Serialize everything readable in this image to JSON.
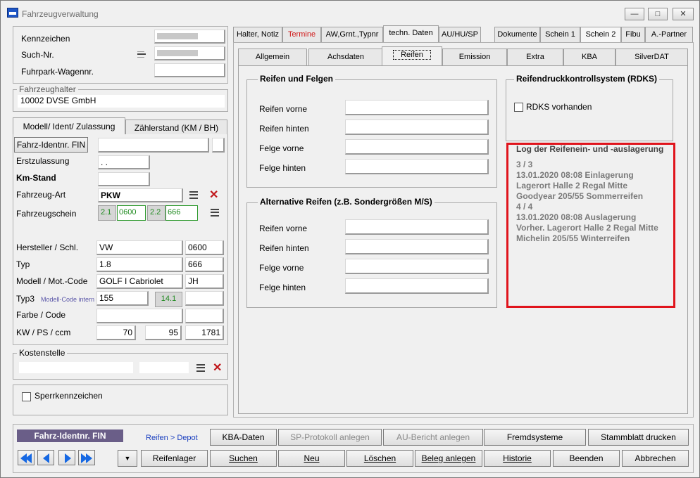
{
  "window": {
    "title": "Fahrzeugverwaltung"
  },
  "header": {
    "kennzeichen_label": "Kennzeichen",
    "such_nr_label": "Such-Nr.",
    "fuhrpark_label": "Fuhrpark-Wagennr."
  },
  "halter": {
    "group_title": "Fahrzeughalter",
    "value": "10002 DVSE GmbH"
  },
  "left_tabs": {
    "tab1": "Modell/ Ident/ Zulassung",
    "tab2": "Zählerstand (KM / BH)"
  },
  "vehicle": {
    "fin_button": "Fahrz-Identnr. FIN",
    "erstzulassung_label": "Erstzulassung",
    "erstzulassung_value": ". .",
    "kmstand_label": "Km-Stand",
    "art_label": "Fahrzeug-Art",
    "art_value": "PKW",
    "schein_label": "Fahrzeugschein",
    "schein_21": "2.1",
    "schein_21_value": "0600",
    "schein_22": "2.2",
    "schein_22_value": "666",
    "hersteller_label": "Hersteller / Schl.",
    "hersteller_value": "VW",
    "hersteller_key": "0600",
    "typ_label": "Typ",
    "typ_value": "1.8",
    "typ_key": "666",
    "modell_label": "Modell / Mot.-Code",
    "modell_value": "GOLF I Cabriolet",
    "modell_code": "JH",
    "typ3_label": "Typ3",
    "modell_code_intern": "Modell-Code intern",
    "typ3_value": "155",
    "typ3_key": "14.1",
    "farbe_label": "Farbe / Code",
    "kw_label": "KW / PS / ccm",
    "kw_value": "70",
    "ps_value": "95",
    "ccm_value": "1781"
  },
  "kostenstelle": {
    "group_title": "Kostenstelle"
  },
  "sperr": {
    "label": "Sperrkennzeichen"
  },
  "main_tabs": [
    "Halter, Notiz",
    "Termine",
    "AW,Grnt.,Typnr",
    "techn. Daten",
    "AU/HU/SP",
    "Dokumente",
    "Schein 1",
    "Schein 2",
    "Fibu",
    "A.-Partner"
  ],
  "sub_tabs": [
    "Allgemein",
    "Achsdaten",
    "Reifen",
    "Emission",
    "Extra",
    "KBA",
    "SilverDAT"
  ],
  "reifen": {
    "group_title": "Reifen und Felgen",
    "vorne": "Reifen vorne",
    "hinten": "Reifen hinten",
    "felge_vorne": "Felge vorne",
    "felge_hinten": "Felge hinten"
  },
  "alt_reifen": {
    "group_title": "Alternative Reifen (z.B. Sondergrößen M/S)",
    "vorne": "Reifen vorne",
    "hinten": "Reifen hinten",
    "felge_vorne": "Felge vorne",
    "felge_hinten": "Felge hinten"
  },
  "rdks": {
    "group_title": "Reifendruckkontrollsystem (RDKS)",
    "checkbox_label": "RDKS vorhanden"
  },
  "log": {
    "group_title": "Log der Reifenein- und -auslagerung",
    "lines": [
      "3 / 3",
      "13.01.2020 08:08 Einlagerung",
      "Lagerort Halle 2 Regal Mitte",
      "Goodyear 205/55 Sommerreifen",
      "4 / 4",
      "13.01.2020 08:08 Auslagerung",
      "Vorher. Lagerort Halle 2 Regal Mitte",
      "Michelin 205/55 Winterreifen"
    ]
  },
  "bottom": {
    "fin_label": "Fahrz-Identnr. FIN",
    "reifen_depot": "Reifen > Depot",
    "kba_daten": "KBA-Daten",
    "sp_protokoll": "SP-Protokoll anlegen",
    "au_bericht": "AU-Bericht anlegen",
    "fremdsysteme": "Fremdsysteme",
    "stammblatt": "Stammblatt drucken",
    "reifenlager": "Reifenlager",
    "suchen": "Suchen",
    "neu": "Neu",
    "loeschen": "Löschen",
    "beleg": "Beleg anlegen",
    "historie": "Historie",
    "beenden": "Beenden",
    "abbrechen": "Abbrechen"
  },
  "colors": {
    "highlight_border": "#e0141c",
    "termine_tab": "#d01818",
    "fin_label_bg": "#6a5e88",
    "link_blue": "#1a3fbf"
  }
}
